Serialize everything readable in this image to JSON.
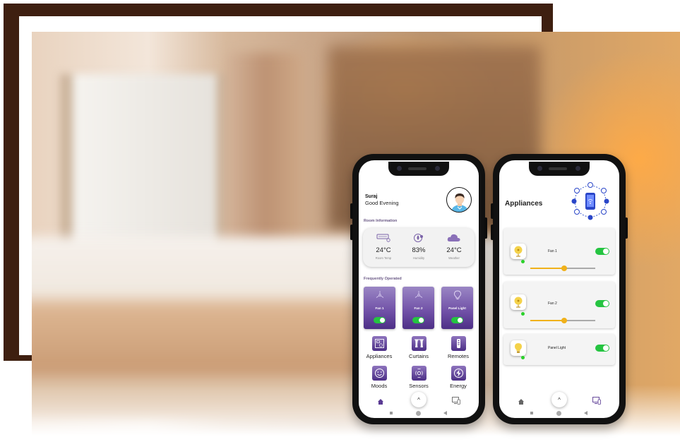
{
  "phone1": {
    "user_name": "Suraj",
    "greeting": "Good Evening",
    "room_info_title": "Room Information",
    "room_stats": [
      {
        "value": "24°C",
        "label": "Room Temp",
        "icon": "ac-icon"
      },
      {
        "value": "83%",
        "label": "Humidity",
        "icon": "humidity-icon"
      },
      {
        "value": "24°C",
        "label": "Weather",
        "icon": "cloud-icon"
      }
    ],
    "frequent_title": "Frequently Operated",
    "frequent_tiles": [
      {
        "label": "Fan 1",
        "icon": "fan-icon",
        "on": true
      },
      {
        "label": "Fan 2",
        "icon": "fan-icon",
        "on": true
      },
      {
        "label": "Panel Light",
        "icon": "bulb-icon",
        "on": true
      }
    ],
    "categories": [
      {
        "label": "Appliances",
        "icon": "appliances-icon"
      },
      {
        "label": "Curtains",
        "icon": "curtains-icon"
      },
      {
        "label": "Remotes",
        "icon": "remote-icon"
      },
      {
        "label": "Moods",
        "icon": "smiley-icon"
      },
      {
        "label": "Sensors",
        "icon": "sensor-icon"
      },
      {
        "label": "Energy",
        "icon": "energy-icon"
      }
    ],
    "nav": {
      "up_label": "^"
    }
  },
  "phone2": {
    "title": "Appliances",
    "items": [
      {
        "name": "Fan 1",
        "on": true,
        "level": 0.52,
        "icon": "fan-icon"
      },
      {
        "name": "Fan 2",
        "on": true,
        "level": 0.52,
        "icon": "fan-icon"
      },
      {
        "name": "Panel Light",
        "on": true,
        "icon": "bulb-icon"
      }
    ],
    "nav": {
      "up_label": "^"
    }
  },
  "colors": {
    "accent_purple": "#5a3a93",
    "toggle_green": "#25c441",
    "slider_yellow": "#f0b11a",
    "frame_brown": "#3e1f10"
  }
}
